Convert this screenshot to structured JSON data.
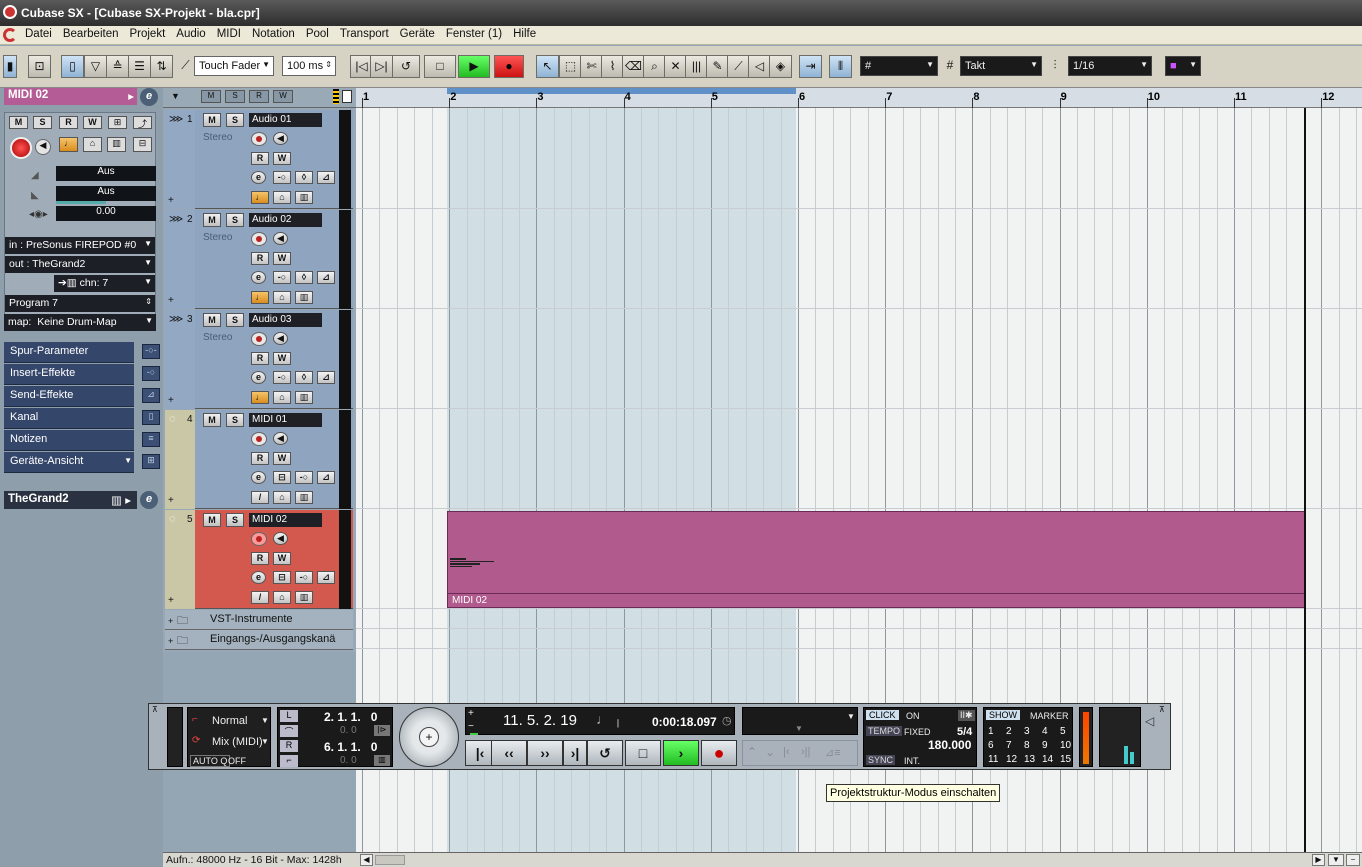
{
  "window": {
    "title": "Cubase SX - [Cubase SX-Projekt - bla.cpr]"
  },
  "menu": [
    "Datei",
    "Bearbeiten",
    "Projekt",
    "Audio",
    "MIDI",
    "Notation",
    "Pool",
    "Transport",
    "Geräte",
    "Fenster (1)",
    "Hilfe"
  ],
  "toolbar": {
    "automation_mode": "Touch Fader",
    "pre_roll": "100 ms",
    "grid_type": "Takt",
    "quantize": "1/16"
  },
  "inspector": {
    "track_name": "MIDI 02",
    "btn_m": "M",
    "btn_s": "S",
    "btn_r": "R",
    "btn_w": "W",
    "fader1": "Aus",
    "fader2": "Aus",
    "pan_value": "0.00",
    "in_label": "in :",
    "in_value": "PreSonus FIREPOD #0",
    "out_label": "out :",
    "out_value": "TheGrand2",
    "chn_label": "chn:",
    "chn_value": "7",
    "program": "Program 7",
    "map_label": "map:",
    "map_value": "Keine Drum-Map",
    "sections": [
      "Spur-Parameter",
      "Insert-Effekte",
      "Send-Effekte",
      "Kanal",
      "Notizen",
      "Geräte-Ansicht"
    ],
    "instrument": "TheGrand2"
  },
  "tracks": [
    {
      "num": "1",
      "name": "Audio 01",
      "type": "audio",
      "sub": "Stereo"
    },
    {
      "num": "2",
      "name": "Audio 02",
      "type": "audio",
      "sub": "Stereo"
    },
    {
      "num": "3",
      "name": "Audio 03",
      "type": "audio",
      "sub": "Stereo"
    },
    {
      "num": "4",
      "name": "MIDI 01",
      "type": "midi",
      "sub": ""
    },
    {
      "num": "5",
      "name": "MIDI 02",
      "type": "midi",
      "sub": ""
    }
  ],
  "folders": [
    "VST-Instrumente",
    "Eingangs-/Ausgangskanä"
  ],
  "ruler": [
    "1",
    "2",
    "3",
    "4",
    "5",
    "6",
    "7",
    "8",
    "9",
    "10",
    "11",
    "12"
  ],
  "part": {
    "name": "MIDI 02"
  },
  "tooltip": "Projektstruktur-Modus einschalten",
  "transport": {
    "mode_normal": "Normal",
    "mode_mix": "Mix (MIDI)",
    "autoq_label": "AUTO Q",
    "autoq_value": "OFF",
    "left_locator": "2. 1. 1.   0",
    "right_locator": "6. 1. 1.   0",
    "zero1": "0. 0",
    "zero2": "0. 0",
    "position_bars": "11. 5. 2. 19",
    "position_time": "0:00:18.097",
    "click_label": "CLICK",
    "click_value": "ON",
    "tempo_label": "TEMPO",
    "tempo_mode": "FIXED",
    "signature": "5/4",
    "tempo_value": "180.000",
    "sync_label": "SYNC",
    "sync_value": "INT.",
    "show_label": "SHOW",
    "marker_label": "MARKER",
    "markers": [
      "1",
      "2",
      "3",
      "4",
      "5",
      "6",
      "7",
      "8",
      "9",
      "10",
      "11",
      "12",
      "13",
      "14",
      "15"
    ]
  },
  "status": "Aufn.: 48000 Hz - 16 Bit - Max: 1428h"
}
